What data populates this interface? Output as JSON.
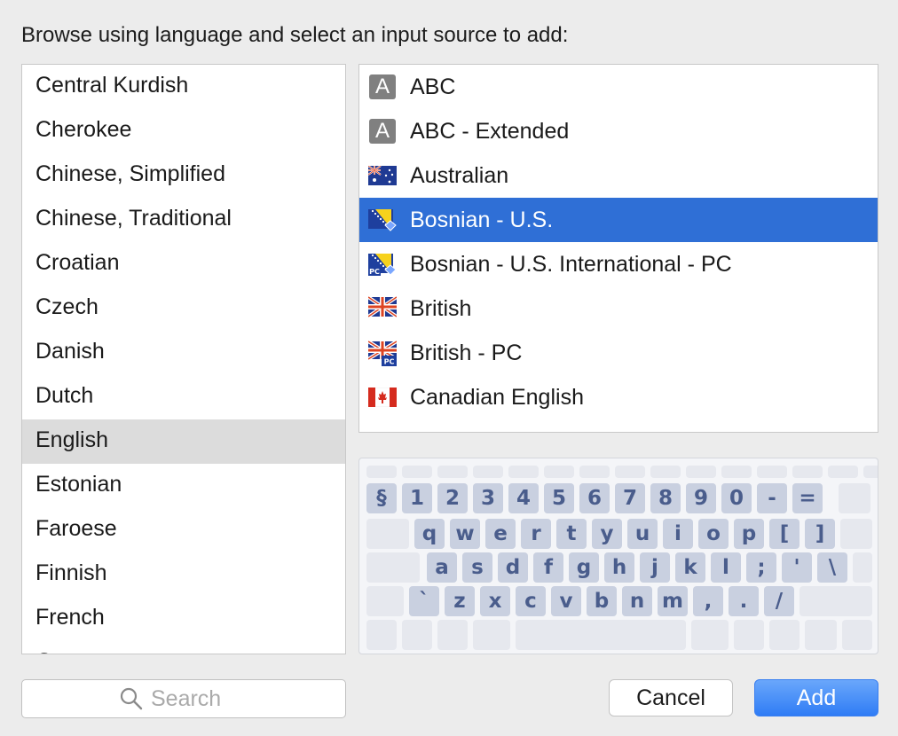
{
  "dialog": {
    "title": "Browse using language and select an input source to add:"
  },
  "languages": [
    {
      "label": "Central Kurdish",
      "selected": false
    },
    {
      "label": "Cherokee",
      "selected": false
    },
    {
      "label": "Chinese, Simplified",
      "selected": false
    },
    {
      "label": "Chinese, Traditional",
      "selected": false
    },
    {
      "label": "Croatian",
      "selected": false
    },
    {
      "label": "Czech",
      "selected": false
    },
    {
      "label": "Danish",
      "selected": false
    },
    {
      "label": "Dutch",
      "selected": false
    },
    {
      "label": "English",
      "selected": true
    },
    {
      "label": "Estonian",
      "selected": false
    },
    {
      "label": "Faroese",
      "selected": false
    },
    {
      "label": "Finnish",
      "selected": false
    },
    {
      "label": "French",
      "selected": false
    },
    {
      "label": "German",
      "selected": false
    }
  ],
  "input_sources": [
    {
      "label": "ABC",
      "icon": "letter-a-icon",
      "badge": "A",
      "selected": false
    },
    {
      "label": "ABC - Extended",
      "icon": "letter-a-icon",
      "badge": "A",
      "selected": false
    },
    {
      "label": "Australian",
      "icon": "australia-flag-icon",
      "selected": false
    },
    {
      "label": "Bosnian - U.S.",
      "icon": "bosnia-flag-icon",
      "selected": true
    },
    {
      "label": "Bosnian - U.S. International - PC",
      "icon": "bosnia-pc-flag-icon",
      "badge": "PC",
      "selected": false
    },
    {
      "label": "British",
      "icon": "uk-flag-icon",
      "selected": false
    },
    {
      "label": "British - PC",
      "icon": "uk-pc-flag-icon",
      "badge": "PC",
      "selected": false
    },
    {
      "label": "Canadian English",
      "icon": "canada-flag-icon",
      "selected": false
    }
  ],
  "keyboard": {
    "row1": [
      "§",
      "1",
      "2",
      "3",
      "4",
      "5",
      "6",
      "7",
      "8",
      "9",
      "0",
      "-",
      "="
    ],
    "row2": [
      "q",
      "w",
      "e",
      "r",
      "t",
      "y",
      "u",
      "i",
      "o",
      "p",
      "[",
      "]"
    ],
    "row3": [
      "a",
      "s",
      "d",
      "f",
      "g",
      "h",
      "j",
      "k",
      "l",
      ";",
      "'",
      "\\"
    ],
    "row4": [
      "`",
      "z",
      "x",
      "c",
      "v",
      "b",
      "n",
      "m",
      ",",
      ".",
      "/"
    ]
  },
  "search": {
    "placeholder": "Search",
    "value": ""
  },
  "buttons": {
    "cancel": "Cancel",
    "add": "Add"
  },
  "colors": {
    "selection_blue": "#2f6fd6",
    "add_button_blue": "#3d8af7",
    "key_glyph": "#4a5d8c"
  }
}
